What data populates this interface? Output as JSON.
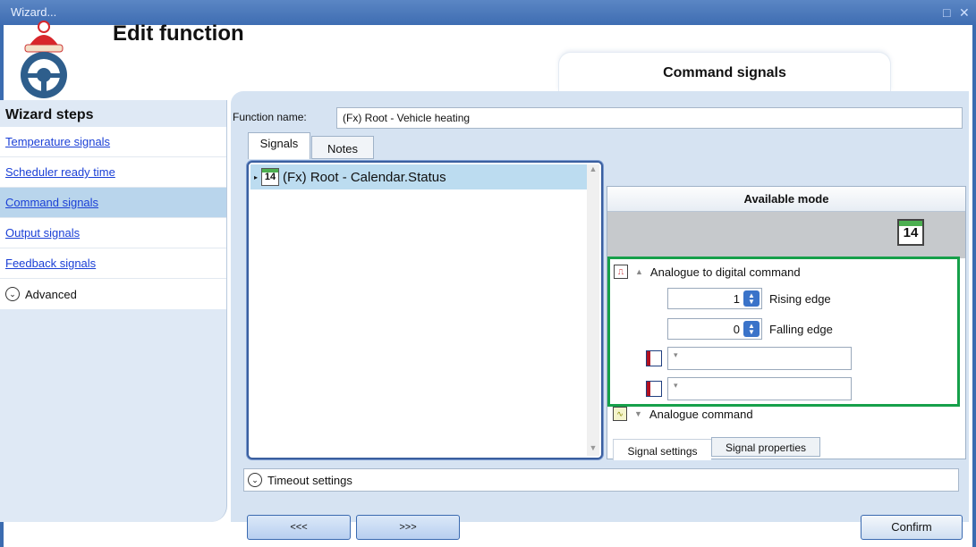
{
  "window": {
    "title": "Wizard...",
    "controls": [
      "□",
      "✕"
    ]
  },
  "header": {
    "title": "Edit function",
    "current_step": "Command signals"
  },
  "sidebar": {
    "heading": "Wizard steps",
    "items": [
      {
        "label": "Temperature signals"
      },
      {
        "label": "Scheduler ready time"
      },
      {
        "label": "Command signals"
      },
      {
        "label": "Output signals"
      },
      {
        "label": "Feedback signals"
      }
    ],
    "advanced_label": "Advanced"
  },
  "function": {
    "name_label": "Function name:",
    "name_value": "(Fx) Root - Vehicle heating"
  },
  "tabs": {
    "signals": "Signals",
    "notes": "Notes"
  },
  "signal_list": {
    "items": [
      {
        "icon_day": "14",
        "label": "(Fx) Root - Calendar.Status"
      }
    ]
  },
  "available_mode": {
    "header": "Available mode",
    "icon_day": "14",
    "analogue_to_digital": {
      "label": "Analogue to digital command",
      "rising_value": "1",
      "rising_label": "Rising edge",
      "falling_value": "0",
      "falling_label": "Falling edge"
    },
    "analogue_label": "Analogue command",
    "tabs": {
      "settings": "Signal settings",
      "properties": "Signal properties"
    }
  },
  "timeout_label": "Timeout settings",
  "nav": {
    "prev": "<<<",
    "next": ">>>",
    "confirm": "Confirm"
  },
  "colors": {
    "titlebar": "#3e6db2",
    "highlight": "#16a04a",
    "active_step": "#b9d5ec",
    "link": "#1a3fd6"
  }
}
